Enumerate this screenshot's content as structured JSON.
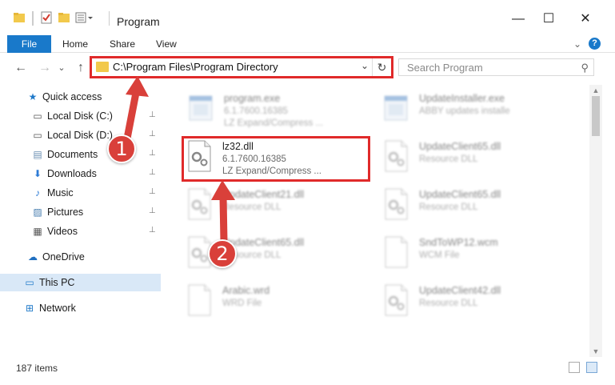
{
  "window": {
    "title": "Program",
    "minimize_glyph": "—",
    "maximize_glyph": "☐",
    "close_glyph": "✕"
  },
  "ribbon": {
    "tabs": [
      "File",
      "Home",
      "Share",
      "View"
    ],
    "expand_glyph": "⌄",
    "help_glyph": "?"
  },
  "nav": {
    "back_glyph": "←",
    "forward_glyph": "→",
    "recent_glyph": "⌄",
    "up_glyph": "↑",
    "address": "C:\\Program Files\\Program Directory",
    "address_dropdown_glyph": "⌄",
    "refresh_glyph": "↻",
    "search_placeholder": "Search Program",
    "search_glyph": "⚲"
  },
  "sidebar": {
    "items": [
      {
        "label": "Quick access",
        "icon": "star-icon",
        "glyph": "★",
        "color": "#1f79c9",
        "pinned": false
      },
      {
        "label": "Local Disk (C:)",
        "icon": "drive-icon",
        "glyph": "▭",
        "color": "#555555",
        "pinned": true
      },
      {
        "label": "Local Disk (D:)",
        "icon": "drive-icon",
        "glyph": "▭",
        "color": "#555555",
        "pinned": true
      },
      {
        "label": "Documents",
        "icon": "documents-icon",
        "glyph": "▤",
        "color": "#6b8fb3",
        "pinned": true
      },
      {
        "label": "Downloads",
        "icon": "downloads-icon",
        "glyph": "⬇",
        "color": "#2d7bd6",
        "pinned": true
      },
      {
        "label": "Music",
        "icon": "music-icon",
        "glyph": "♪",
        "color": "#2d7bd6",
        "pinned": true
      },
      {
        "label": "Pictures",
        "icon": "pictures-icon",
        "glyph": "▨",
        "color": "#4a7fb0",
        "pinned": true
      },
      {
        "label": "Videos",
        "icon": "videos-icon",
        "glyph": "▦",
        "color": "#555555",
        "pinned": true
      },
      {
        "label": "OneDrive",
        "icon": "cloud-icon",
        "glyph": "☁",
        "color": "#1f6fc0",
        "pinned": false
      },
      {
        "label": "This PC",
        "icon": "computer-icon",
        "glyph": "▭",
        "color": "#1f79c9",
        "pinned": false,
        "selected": true
      },
      {
        "label": "Network",
        "icon": "network-icon",
        "glyph": "⊞",
        "color": "#1f79c9",
        "pinned": false
      }
    ],
    "pin_glyph": "📌"
  },
  "files": [
    {
      "name": "program.exe",
      "meta1": "6.1.7600.16385",
      "meta2": "LZ Expand/Compress ...",
      "kind": "exe",
      "blurred": true
    },
    {
      "name": "UpdateInstaller.exe",
      "meta1": "ABBY updates installe",
      "meta2": "",
      "kind": "exe",
      "blurred": true
    },
    {
      "name": "lz32.dll",
      "meta1": "6.1.7600.16385",
      "meta2": "LZ Expand/Compress ...",
      "kind": "dll",
      "blurred": false
    },
    {
      "name": "UpdateClient65.dll",
      "meta1": "Resource DLL",
      "meta2": "",
      "kind": "dll",
      "blurred": true
    },
    {
      "name": "UpdateClient21.dll",
      "meta1": "Resource DLL",
      "meta2": "",
      "kind": "dll",
      "blurred": true
    },
    {
      "name": "UpdateClient65.dll",
      "meta1": "Resource DLL",
      "meta2": "",
      "kind": "dll",
      "blurred": true
    },
    {
      "name": "UpdateClient65.dll",
      "meta1": "Resource DLL",
      "meta2": "",
      "kind": "dll",
      "blurred": true
    },
    {
      "name": "SndToWP12.wcm",
      "meta1": "WCM File",
      "meta2": "",
      "kind": "doc",
      "blurred": true
    },
    {
      "name": "Arabic.wrd",
      "meta1": "WRD File",
      "meta2": "",
      "kind": "doc",
      "blurred": true
    },
    {
      "name": "UpdateClient42.dll",
      "meta1": "Resource DLL",
      "meta2": "",
      "kind": "dll",
      "blurred": true
    }
  ],
  "callouts": [
    "1",
    "2"
  ],
  "status": {
    "item_count": "187 items"
  },
  "colors": {
    "accent": "#1979ca",
    "highlight": "#e02a2a",
    "callout": "#d9403a",
    "selected": "#d9e8f7"
  }
}
